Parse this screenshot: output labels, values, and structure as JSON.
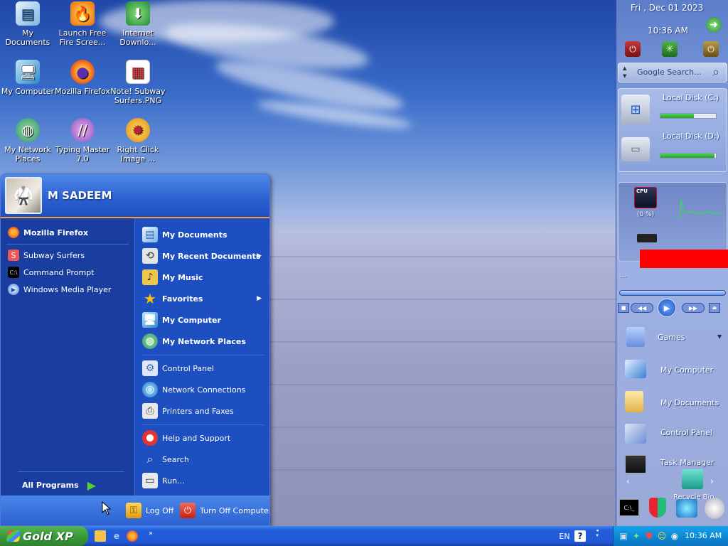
{
  "desktop": {
    "icons": [
      {
        "label": "My Documents",
        "icon": "my-documents-icon"
      },
      {
        "label": "Launch Free Fire Scree...",
        "icon": "fire-icon"
      },
      {
        "label": "Internet Downlo...",
        "icon": "download-manager-icon"
      },
      {
        "label": "My Computer",
        "icon": "computer-icon"
      },
      {
        "label": "Mozilla Firefox",
        "icon": "firefox-icon"
      },
      {
        "label": "Note! Subway Surfers.PNG",
        "icon": "image-file-icon"
      },
      {
        "label": "My Network Places",
        "icon": "network-icon"
      },
      {
        "label": "Typing Master 7.0",
        "icon": "typing-master-icon"
      },
      {
        "label": "Right Click Image ...",
        "icon": "gear-icon"
      }
    ]
  },
  "start_menu": {
    "user_name": "M SADEEM",
    "pinned": [
      {
        "label": "Mozilla Firefox",
        "icon": "firefox-icon"
      }
    ],
    "recent": [
      {
        "label": "Subway Surfers",
        "icon": "subway-surfers-icon"
      },
      {
        "label": "Command Prompt",
        "icon": "command-prompt-icon"
      },
      {
        "label": "Windows Media Player",
        "icon": "media-player-icon"
      }
    ],
    "all_programs": "All Programs",
    "places": [
      {
        "label": "My Documents",
        "icon": "my-documents-icon"
      },
      {
        "label": "My Recent Documents",
        "icon": "recent-documents-icon"
      },
      {
        "label": "My Music",
        "icon": "music-icon"
      },
      {
        "label": "Favorites",
        "icon": "star-icon"
      },
      {
        "label": "My Computer",
        "icon": "computer-icon"
      },
      {
        "label": "My Network Places",
        "icon": "network-icon"
      }
    ],
    "settings": [
      {
        "label": "Control Panel",
        "icon": "control-panel-icon"
      },
      {
        "label": "Network Connections",
        "icon": "network-connections-icon"
      },
      {
        "label": "Printers and Faxes",
        "icon": "printer-icon"
      }
    ],
    "tools": [
      {
        "label": "Help and Support",
        "icon": "help-icon"
      },
      {
        "label": "Search",
        "icon": "search-icon"
      },
      {
        "label": "Run...",
        "icon": "run-icon"
      }
    ],
    "log_off": "Log Off",
    "turn_off": "Turn Off Computer"
  },
  "sidebar": {
    "date": "Fri , Dec 01 2023",
    "time": "10:36 AM",
    "search_placeholder": "Google Search...",
    "disks": [
      {
        "label": "Local Disk (C:)",
        "used_fraction": 0.6
      },
      {
        "label": "Local Disk (D:)",
        "used_fraction": 0.98
      }
    ],
    "cpu_label": "CPU",
    "cpu_percent": "(0 %)",
    "player_title": "---",
    "launcher": [
      {
        "label": "Games",
        "icon": "folder-icon"
      },
      {
        "label": "My Computer",
        "icon": "computer-icon"
      },
      {
        "label": "My Documents",
        "icon": "folder-icon"
      },
      {
        "label": "Control Panel",
        "icon": "control-panel-icon"
      },
      {
        "label": "Task Manager",
        "icon": "task-manager-icon"
      },
      {
        "label": "Recycle Bin",
        "icon": "recycle-bin-icon"
      }
    ]
  },
  "taskbar": {
    "start_label": "Gold XP",
    "language": "EN",
    "clock": "10:36 AM"
  },
  "colors": {
    "start_button": "#3a9b3a",
    "taskbar": "#245edb",
    "tray": "#0e8ad7",
    "start_menu_accent": "#f59b40"
  }
}
